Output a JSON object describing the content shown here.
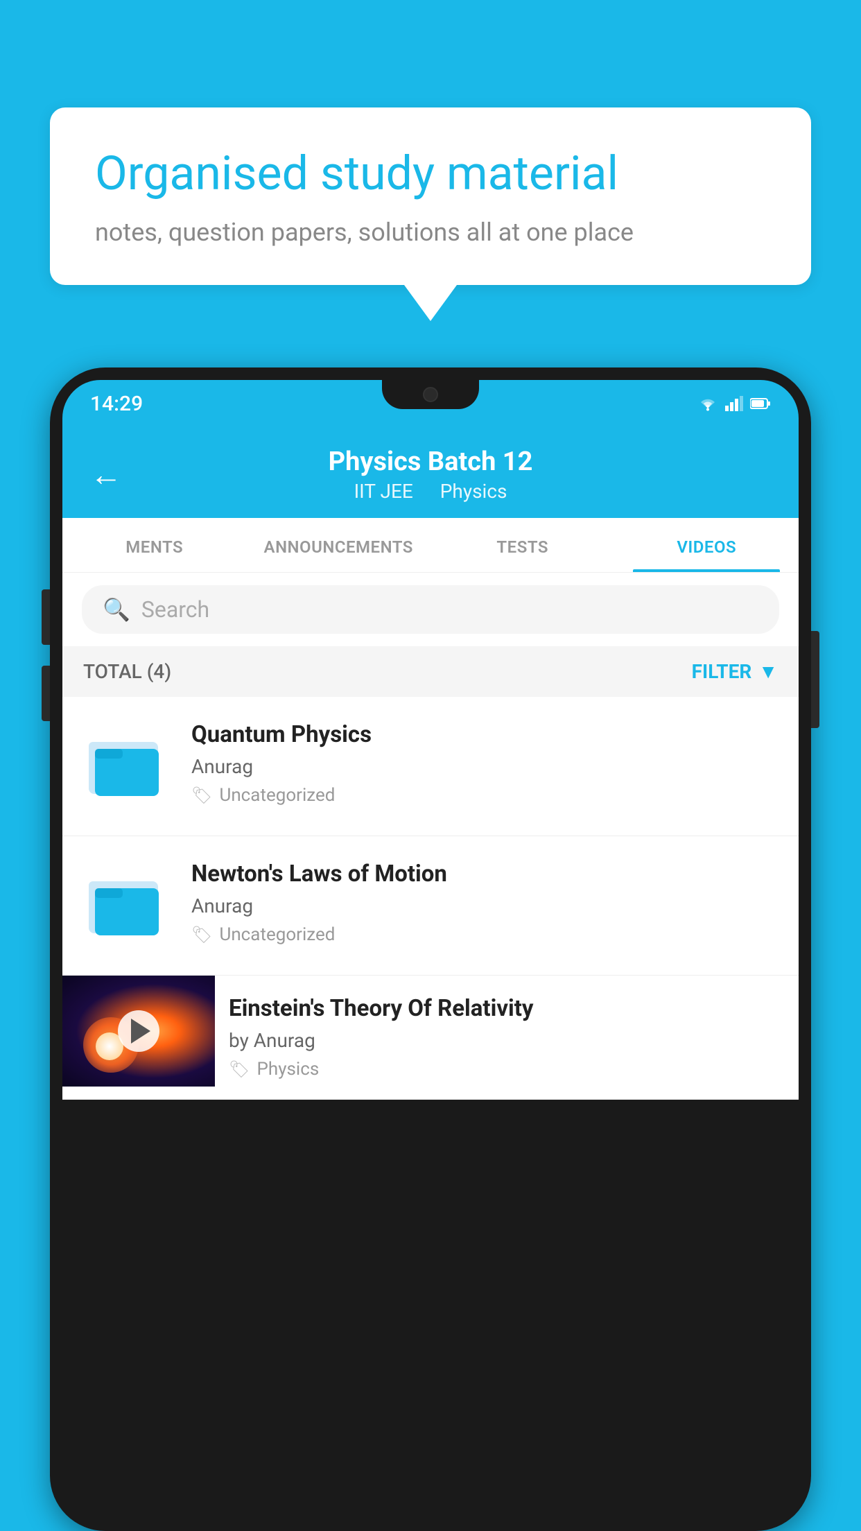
{
  "background_color": "#1ab8e8",
  "bubble": {
    "title": "Organised study material",
    "subtitle": "notes, question papers, solutions all at one place"
  },
  "phone": {
    "status_bar": {
      "time": "14:29"
    },
    "header": {
      "title": "Physics Batch 12",
      "subtitle_part1": "IIT JEE",
      "subtitle_part2": "Physics",
      "back_label": "←"
    },
    "tabs": [
      {
        "label": "MENTS",
        "active": false
      },
      {
        "label": "ANNOUNCEMENTS",
        "active": false
      },
      {
        "label": "TESTS",
        "active": false
      },
      {
        "label": "VIDEOS",
        "active": true
      }
    ],
    "search": {
      "placeholder": "Search"
    },
    "filter": {
      "total_label": "TOTAL (4)",
      "filter_label": "FILTER"
    },
    "videos": [
      {
        "id": 1,
        "title": "Quantum Physics",
        "author": "Anurag",
        "tag": "Uncategorized",
        "has_thumb": false
      },
      {
        "id": 2,
        "title": "Newton's Laws of Motion",
        "author": "Anurag",
        "tag": "Uncategorized",
        "has_thumb": false
      },
      {
        "id": 3,
        "title": "Einstein's Theory Of Relativity",
        "author": "by Anurag",
        "tag": "Physics",
        "has_thumb": true
      }
    ]
  }
}
